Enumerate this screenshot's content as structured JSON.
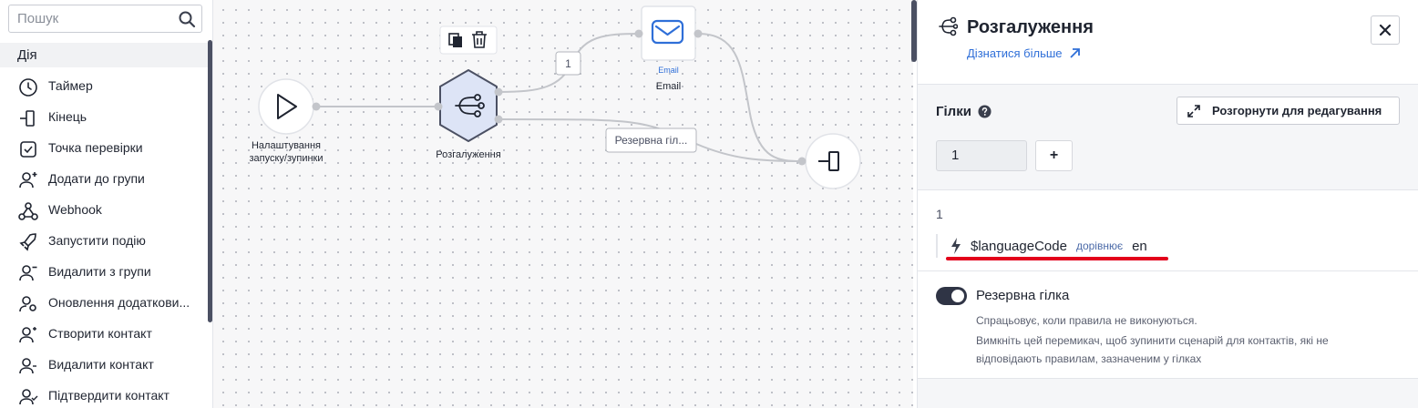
{
  "sidebar": {
    "search_placeholder": "Пошук",
    "section_title": "Дія",
    "items": [
      {
        "label": "Таймер",
        "icon": "timer-icon"
      },
      {
        "label": "Кінець",
        "icon": "end-icon"
      },
      {
        "label": "Точка перевірки",
        "icon": "checkpoint-icon"
      },
      {
        "label": "Додати до групи",
        "icon": "add-to-group-icon"
      },
      {
        "label": "Webhook",
        "icon": "webhook-icon"
      },
      {
        "label": "Запустити подію",
        "icon": "rocket-icon"
      },
      {
        "label": "Видалити з групи",
        "icon": "remove-from-group-icon"
      },
      {
        "label": "Оновлення додаткови...",
        "icon": "update-fields-icon"
      },
      {
        "label": "Створити контакт",
        "icon": "create-contact-icon"
      },
      {
        "label": "Видалити контакт",
        "icon": "delete-contact-icon"
      },
      {
        "label": "Підтвердити контакт",
        "icon": "confirm-contact-icon"
      }
    ]
  },
  "canvas": {
    "start_node": {
      "label_line1": "Налаштування",
      "label_line2": "запуску/зупинки",
      "icon": "play-icon"
    },
    "branch_node": {
      "label": "Розгалуження",
      "icon": "branch-icon"
    },
    "email_node": {
      "caption": "Email",
      "label": "Email",
      "icon": "envelope-icon"
    },
    "end_node": {
      "icon": "end-icon"
    },
    "edge_label_branch": "1",
    "edge_label_fallback": "Резервна гіл...",
    "node_toolbar": {
      "copy_icon": "copy-icon",
      "delete_icon": "trash-icon"
    }
  },
  "panel": {
    "title": "Розгалуження",
    "title_icon": "branch-icon",
    "learn_more": "Дізнатися більше",
    "branches_label": "Гілки",
    "expand_button": "Розгорнути для редагування",
    "branch_count": "1",
    "add_button": "+",
    "branch": {
      "name": "1",
      "rule_variable": "$languageCode",
      "rule_operator": "дорівнює",
      "rule_value": "en"
    },
    "fallback": {
      "label": "Резервна гілка",
      "enabled": true,
      "description1": "Спрацьовує, коли правила не виконуються.",
      "description2": "Вимкніть цей перемикач, щоб зупинити сценарій для контактів, які не відповідають правилам, зазначеним у гілках"
    }
  },
  "colors": {
    "accent_blue": "#2f6fd8",
    "branch_node_fill": "#dde4f6",
    "branch_node_stroke": "#4b5063",
    "highlight_red": "#e3001b",
    "toggle_on": "#2f3445"
  }
}
